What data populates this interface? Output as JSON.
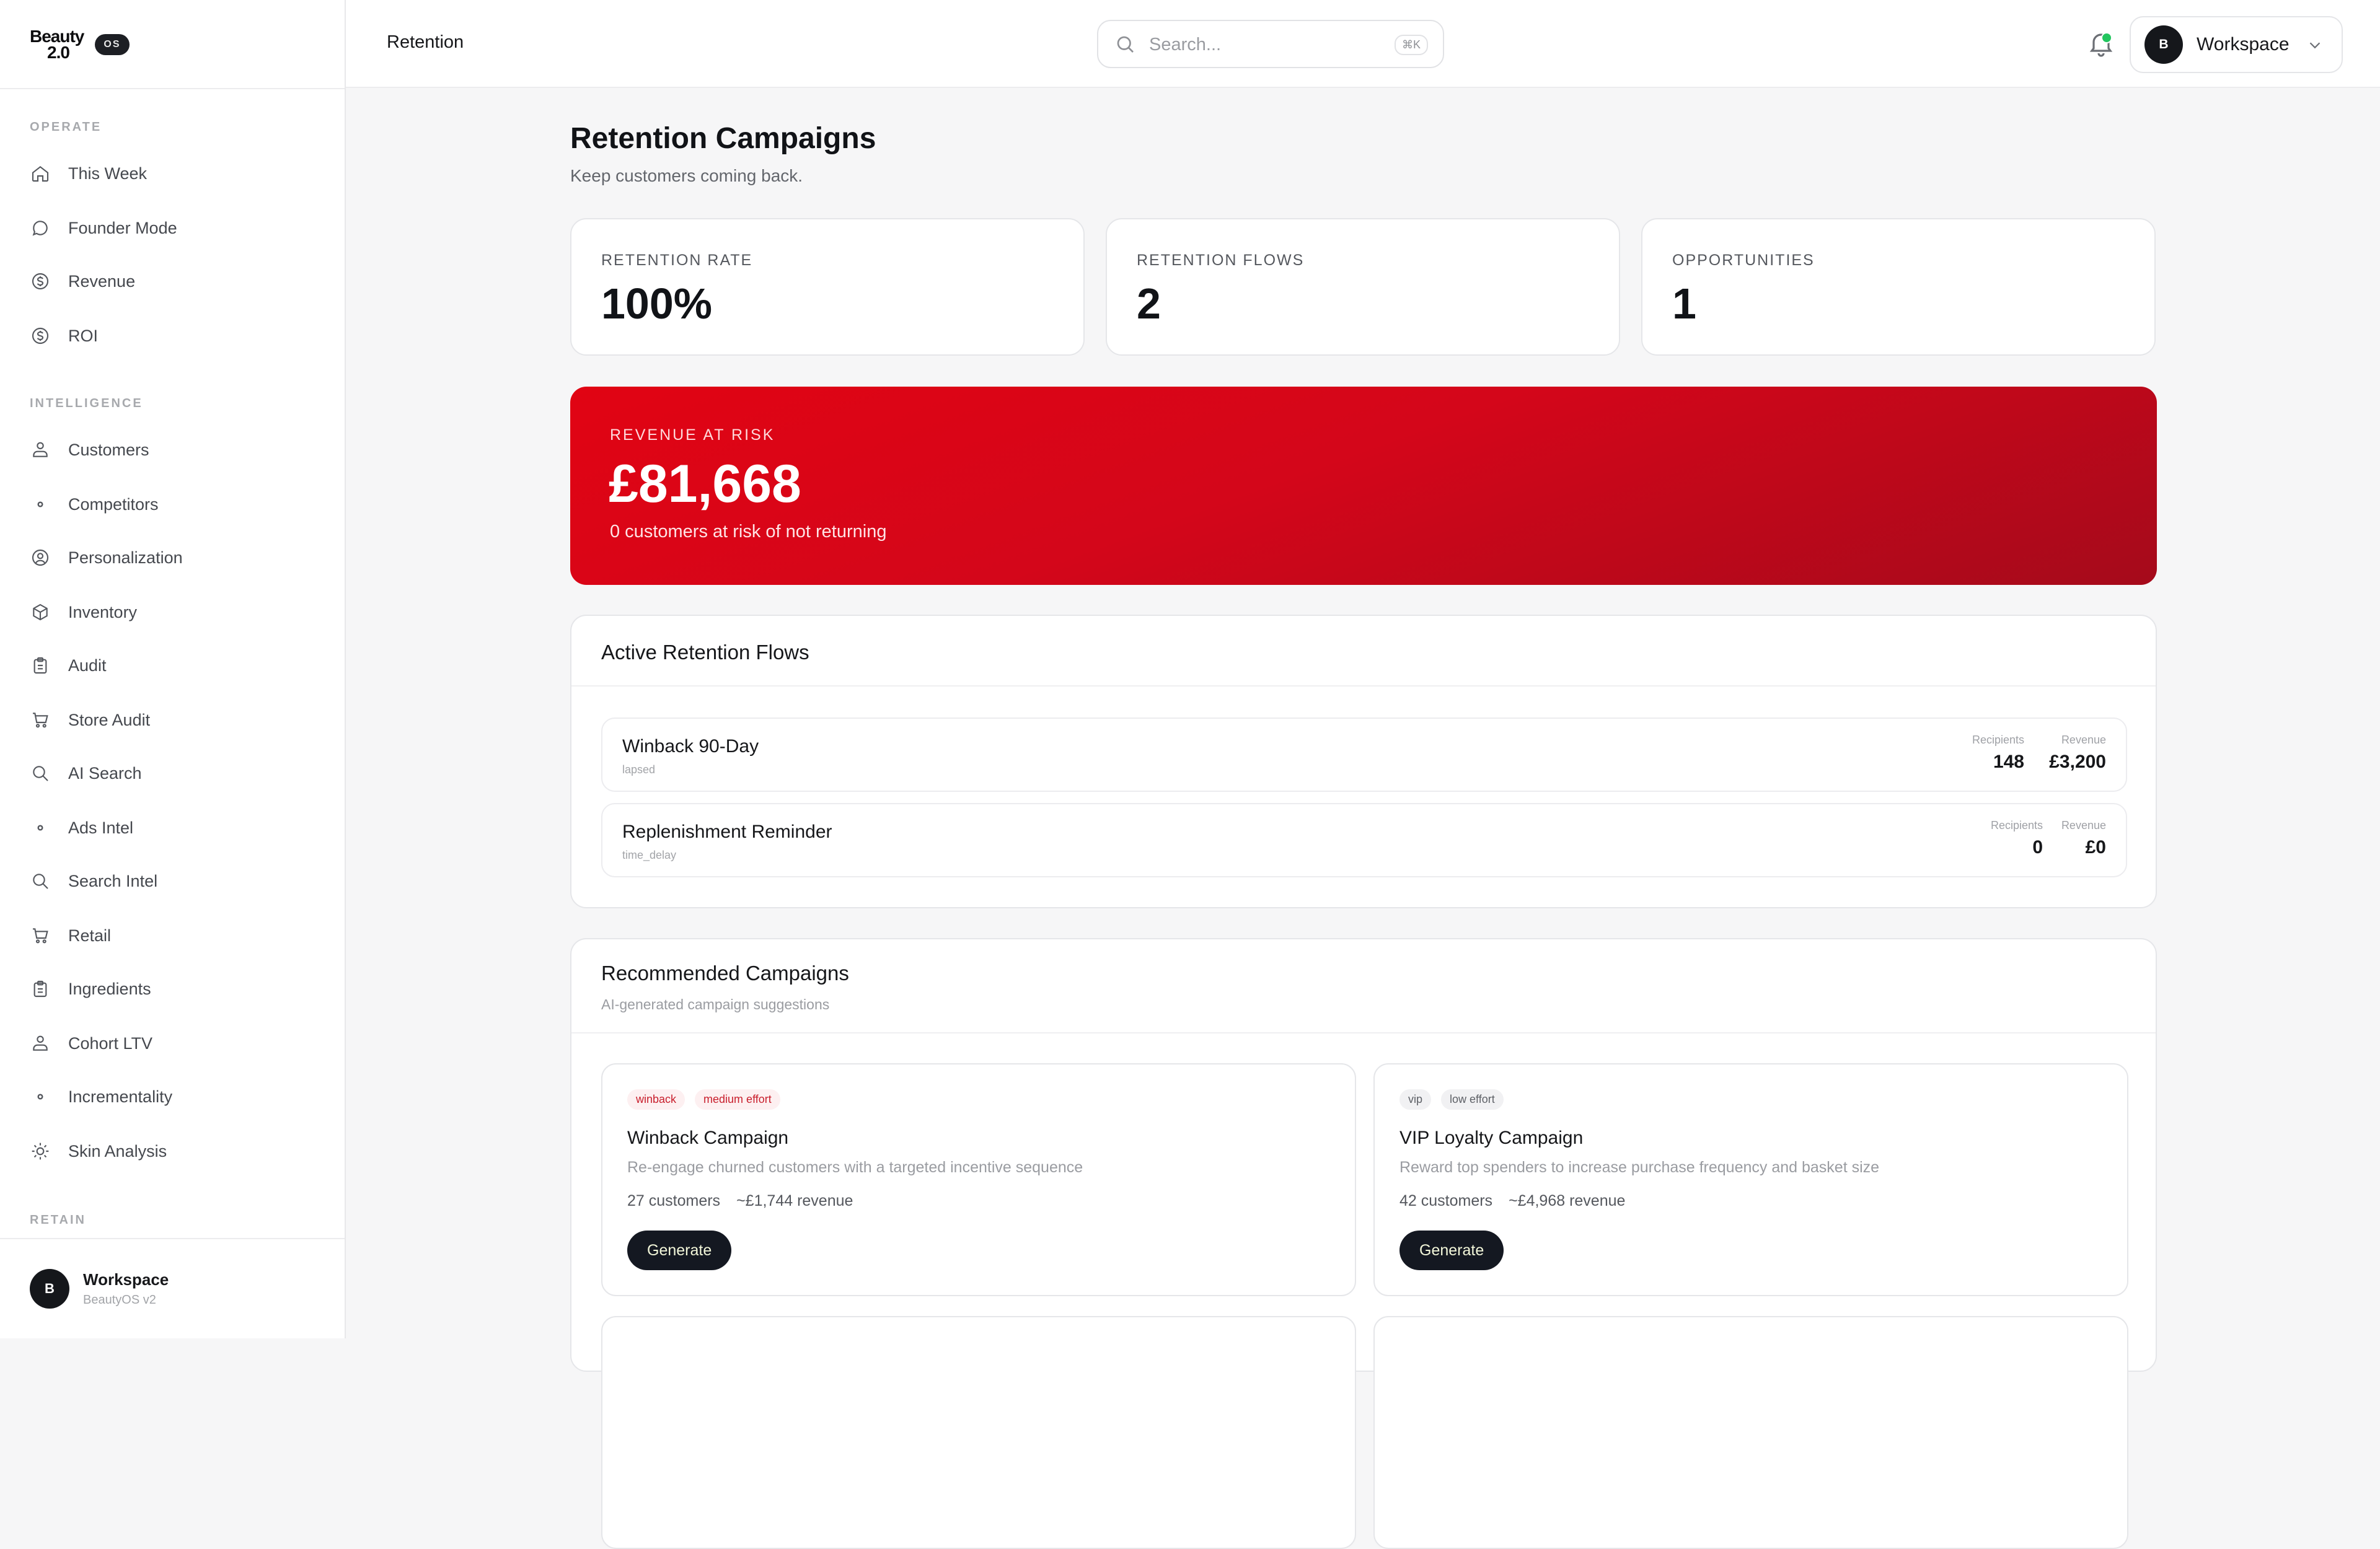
{
  "brand": {
    "logo_line1": "Beauty",
    "logo_line2": "2.0",
    "badge": "OS"
  },
  "header": {
    "title": "Retention",
    "search_placeholder": "Search...",
    "search_shortcut": "⌘K",
    "workspace_avatar": "B",
    "workspace_label": "Workspace"
  },
  "sidebar": {
    "sections": [
      {
        "label": "OPERATE",
        "items": [
          {
            "label": "This Week",
            "icon": "home-icon"
          },
          {
            "label": "Founder Mode",
            "icon": "chat-bubble-icon"
          },
          {
            "label": "Revenue",
            "icon": "dollar-circle-icon"
          },
          {
            "label": "ROI",
            "icon": "dollar-circle-icon"
          }
        ]
      },
      {
        "label": "INTELLIGENCE",
        "items": [
          {
            "label": "Customers",
            "icon": "users-icon"
          },
          {
            "label": "Competitors",
            "icon": "dot-icon"
          },
          {
            "label": "Personalization",
            "icon": "user-circle-icon"
          },
          {
            "label": "Inventory",
            "icon": "box-icon"
          },
          {
            "label": "Audit",
            "icon": "clipboard-icon"
          },
          {
            "label": "Store Audit",
            "icon": "cart-icon"
          },
          {
            "label": "AI Search",
            "icon": "search-icon"
          },
          {
            "label": "Ads Intel",
            "icon": "dot-icon"
          },
          {
            "label": "Search Intel",
            "icon": "search-icon"
          },
          {
            "label": "Retail",
            "icon": "cart-icon"
          },
          {
            "label": "Ingredients",
            "icon": "clipboard-icon"
          },
          {
            "label": "Cohort LTV",
            "icon": "users-icon"
          },
          {
            "label": "Incrementality",
            "icon": "dot-icon"
          },
          {
            "label": "Skin Analysis",
            "icon": "sun-icon"
          }
        ]
      },
      {
        "label": "RETAIN",
        "items": []
      }
    ],
    "footer": {
      "avatar": "B",
      "name": "Workspace",
      "sub": "BeautyOS v2"
    }
  },
  "page": {
    "title": "Retention Campaigns",
    "subtitle": "Keep customers coming back."
  },
  "stats": [
    {
      "label": "RETENTION RATE",
      "value": "100%"
    },
    {
      "label": "RETENTION FLOWS",
      "value": "2"
    },
    {
      "label": "OPPORTUNITIES",
      "value": "1"
    }
  ],
  "risk": {
    "label": "REVENUE AT RISK",
    "value": "£81,668",
    "sub": "0 customers at risk of not returning"
  },
  "flows": {
    "title": "Active Retention Flows",
    "recipients_label": "Recipients",
    "revenue_label": "Revenue",
    "items": [
      {
        "name": "Winback 90-Day",
        "tag": "lapsed",
        "recipients": "148",
        "revenue": "£3,200"
      },
      {
        "name": "Replenishment Reminder",
        "tag": "time_delay",
        "recipients": "0",
        "revenue": "£0"
      }
    ]
  },
  "recommended": {
    "title": "Recommended Campaigns",
    "subtitle": "AI-generated campaign suggestions",
    "cards": [
      {
        "chips": [
          "winback",
          "medium effort"
        ],
        "chip_style": "red",
        "title": "Winback Campaign",
        "desc": "Re-engage churned customers with a targeted incentive sequence",
        "customers": "27 customers",
        "revenue": "~£1,744 revenue",
        "button": "Generate"
      },
      {
        "chips": [
          "vip",
          "low effort"
        ],
        "chip_style": "gray",
        "title": "VIP Loyalty Campaign",
        "desc": "Reward top spenders to increase purchase frequency and basket size",
        "customers": "42 customers",
        "revenue": "~£4,968 revenue",
        "button": "Generate"
      }
    ]
  },
  "colors": {
    "risk_gradient_start": "#e10413",
    "risk_gradient_end": "#a50a1b",
    "button_bg": "#141821",
    "notification_dot": "#22c55e"
  }
}
